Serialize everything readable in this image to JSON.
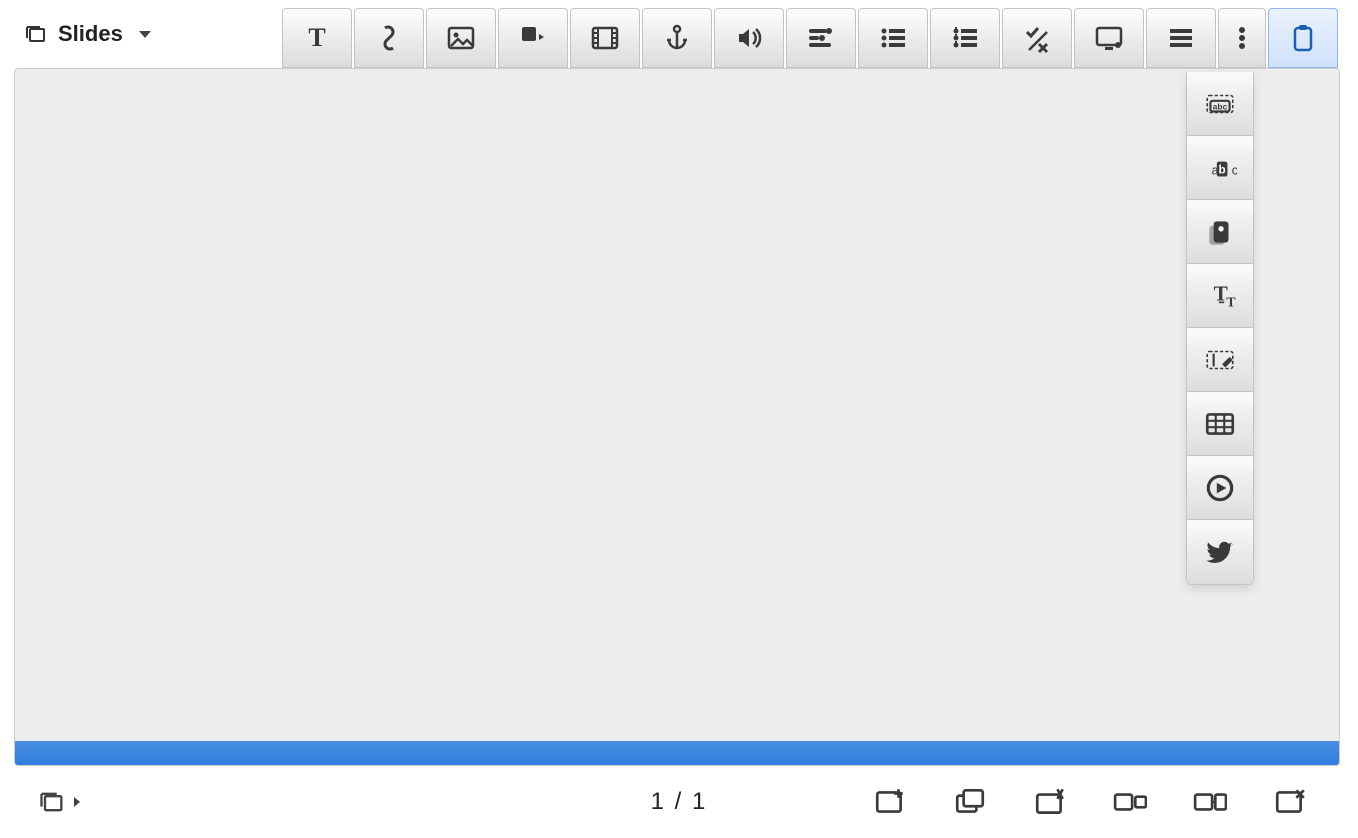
{
  "view": {
    "label": "Slides"
  },
  "toolbar": {
    "items": [
      {
        "name": "text-tool",
        "icon": "text"
      },
      {
        "name": "link-tool",
        "icon": "link"
      },
      {
        "name": "image-tool",
        "icon": "image"
      },
      {
        "name": "shape-tool",
        "icon": "shape"
      },
      {
        "name": "video-tool",
        "icon": "film"
      },
      {
        "name": "anchor-tool",
        "icon": "anchor"
      },
      {
        "name": "audio-tool",
        "icon": "sound"
      },
      {
        "name": "align-tool",
        "icon": "sliders"
      },
      {
        "name": "bullets-tool",
        "icon": "bullets"
      },
      {
        "name": "numbered-tool",
        "icon": "numbered"
      },
      {
        "name": "check-math-tool",
        "icon": "checkx"
      },
      {
        "name": "presentation-tab-tool",
        "icon": "screen"
      },
      {
        "name": "list-lines-tool",
        "icon": "lines"
      },
      {
        "name": "more-tool",
        "icon": "more",
        "narrow": true
      },
      {
        "name": "clipboard-tool",
        "icon": "clipboard",
        "selected": true
      }
    ]
  },
  "more_panel": {
    "items": [
      {
        "name": "select-text-tool",
        "icon": "selabc"
      },
      {
        "name": "abc-highlight-tool",
        "icon": "abc"
      },
      {
        "name": "cards-tool",
        "icon": "cards"
      },
      {
        "name": "typography-tool",
        "icon": "tt"
      },
      {
        "name": "edit-area-tool",
        "icon": "editbox"
      },
      {
        "name": "table-tool",
        "icon": "table"
      },
      {
        "name": "play-tool",
        "icon": "play"
      },
      {
        "name": "twitter-tool",
        "icon": "twitter"
      }
    ]
  },
  "page": {
    "current": "1",
    "separator": "/",
    "total": "1"
  },
  "bottom_actions": {
    "items": [
      {
        "name": "add-slide-button",
        "icon": "addslide"
      },
      {
        "name": "duplicate-slide-button",
        "icon": "duplicate"
      },
      {
        "name": "template-slide-button",
        "icon": "sparkslide"
      },
      {
        "name": "split-view-button",
        "icon": "splitview"
      },
      {
        "name": "merge-view-button",
        "icon": "mergeview"
      },
      {
        "name": "close-slide-button",
        "icon": "closeslide"
      }
    ]
  }
}
